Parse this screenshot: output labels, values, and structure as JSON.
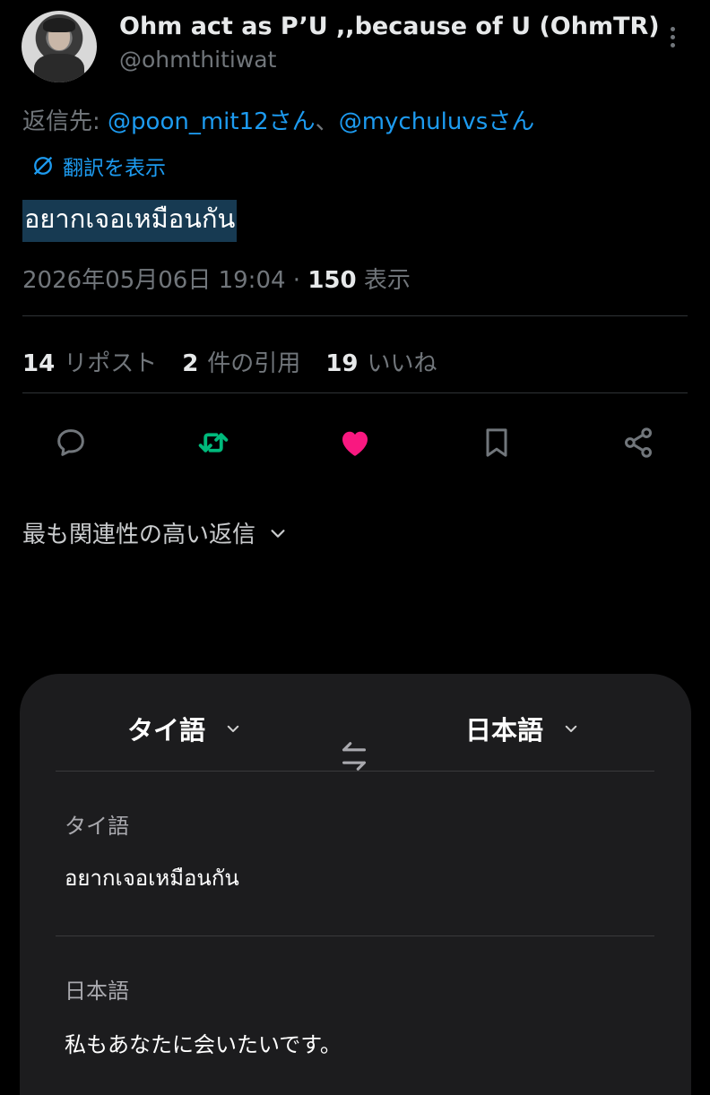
{
  "tweet": {
    "display_name": "Ohm act as P’U ,,because of U (OhmTR)",
    "handle": "@ohmthitiwat",
    "reply_prefix": "返信先: ",
    "reply_mention_1": "@poon_mit12さん",
    "reply_separator": "、",
    "reply_mention_2": "@mychuluvsさん",
    "translate_label": "翻訳を表示",
    "text": "อยากเจอเหมือนกัน",
    "timestamp": "2026年05月06日 19:04",
    "meta_separator": " · ",
    "views_count": "150",
    "views_label": "表示"
  },
  "stats": {
    "reposts_count": "14",
    "reposts_label": "リポスト",
    "quotes_count": "2",
    "quotes_label": "件の引用",
    "likes_count": "19",
    "likes_label": "いいね"
  },
  "actions": {
    "icons": [
      "reply-icon",
      "retweet-icon",
      "like-icon",
      "bookmark-icon",
      "share-icon"
    ],
    "retweet_color": "#00ba7c",
    "like_color": "#f91880",
    "default_color": "#71767b"
  },
  "sort": {
    "label": "最も関連性の高い返信"
  },
  "translation_sheet": {
    "source_lang": "タイ語",
    "target_lang": "日本語",
    "source_label": "タイ語",
    "source_text": "อยากเจอเหมือนกัน",
    "target_label": "日本語",
    "target_text": "私もあなたに会いたいです。"
  }
}
